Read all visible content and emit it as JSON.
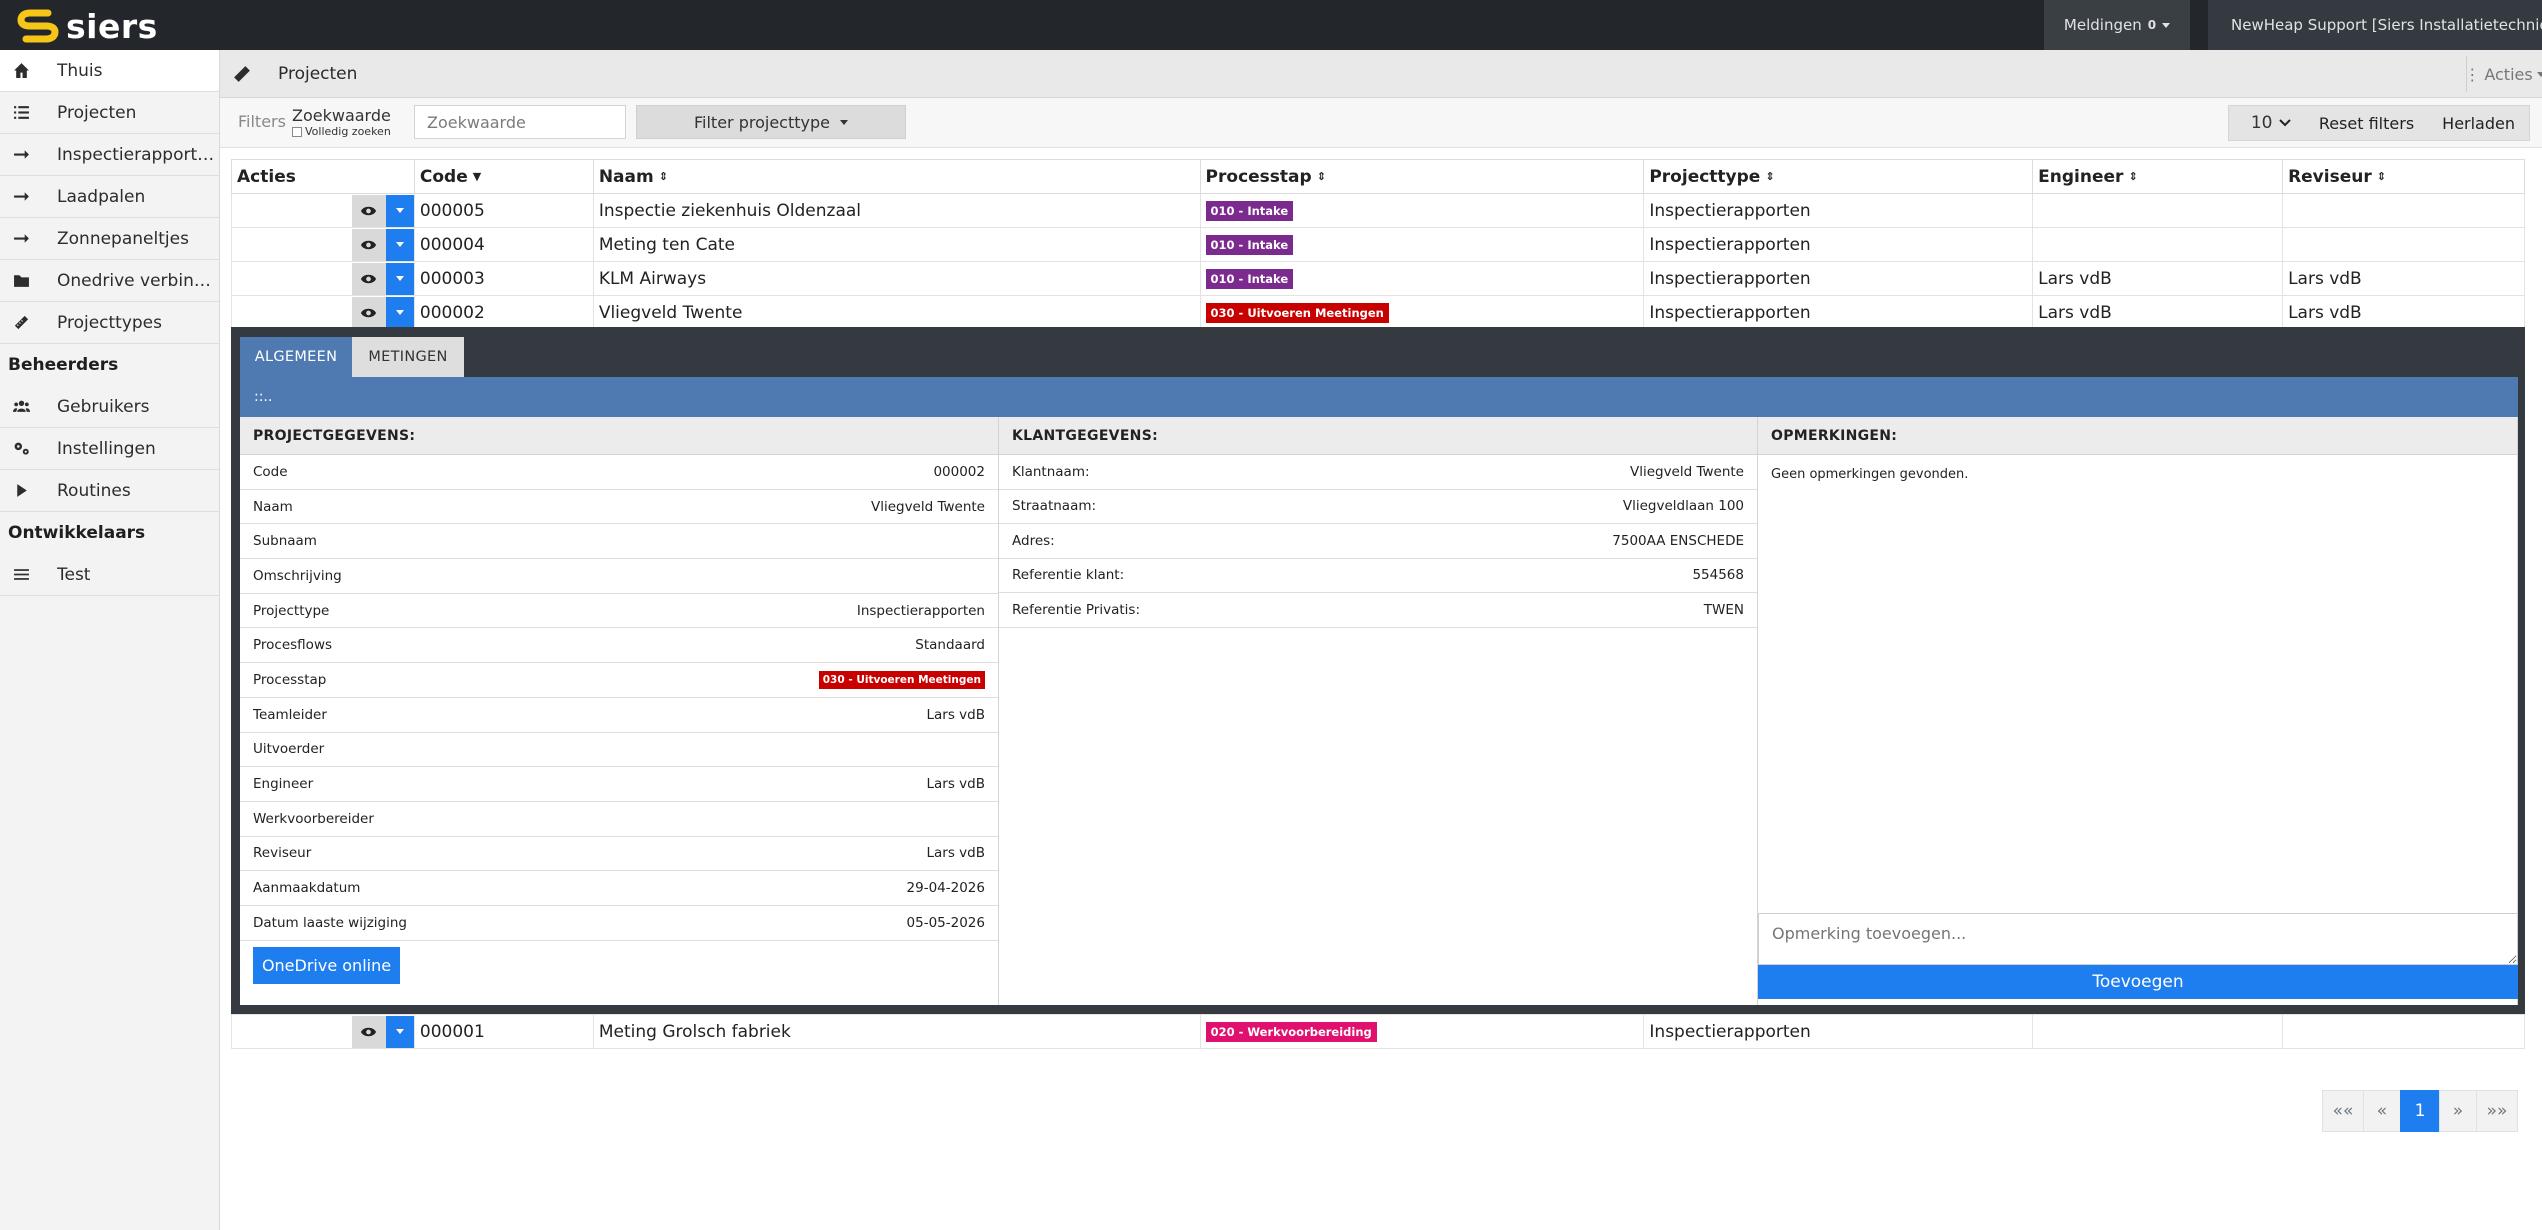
{
  "brand": {
    "name": "siers",
    "logo_color": "#f5c518"
  },
  "topbar": {
    "notifications_label": "Meldingen",
    "notifications_count": "0",
    "user_label": "NewHeap Support [Siers Installatietechniek]"
  },
  "sidebar": {
    "items": [
      {
        "label": "Thuis",
        "icon": "home-icon"
      },
      {
        "label": "Projecten",
        "icon": "list-icon"
      },
      {
        "label": "Inspectierapporten",
        "icon": "arrow-right-icon"
      },
      {
        "label": "Laadpalen",
        "icon": "arrow-right-icon"
      },
      {
        "label": "Zonnepaneltjes",
        "icon": "arrow-right-icon"
      },
      {
        "label": "Onedrive verbindingen",
        "icon": "folder-icon"
      },
      {
        "label": "Projecttypes",
        "icon": "ruler-icon"
      }
    ],
    "admin_heading": "Beheerders",
    "admin_items": [
      {
        "label": "Gebruikers",
        "icon": "users-icon"
      },
      {
        "label": "Instellingen",
        "icon": "gears-icon"
      },
      {
        "label": "Routines",
        "icon": "play-icon"
      }
    ],
    "dev_heading": "Ontwikkelaars",
    "dev_items": [
      {
        "label": "Test",
        "icon": "menu-icon"
      }
    ]
  },
  "page": {
    "title": "Projecten",
    "actions_label": "Acties"
  },
  "filters": {
    "label": "Filters",
    "search_label": "Zoekwaarde",
    "full_search_label": "Volledig zoeken",
    "search_placeholder": "Zoekwaarde",
    "project_type_filter": "Filter projecttype",
    "per_page": "10",
    "reset_label": "Reset filters",
    "reload_label": "Herladen"
  },
  "table": {
    "headers": [
      "Acties",
      "Code",
      "Naam",
      "Processtap",
      "Projecttype",
      "Engineer",
      "Reviseur"
    ],
    "rows": [
      {
        "code": "000005",
        "naam": "Inspectie ziekenhuis Oldenzaal",
        "processtap": "010 - Intake",
        "badge_color": "#7b2a8e",
        "projecttype": "Inspectierapporten",
        "engineer": "",
        "reviseur": ""
      },
      {
        "code": "000004",
        "naam": "Meting ten Cate",
        "processtap": "010 - Intake",
        "badge_color": "#7b2a8e",
        "projecttype": "Inspectierapporten",
        "engineer": "",
        "reviseur": ""
      },
      {
        "code": "000003",
        "naam": "KLM Airways",
        "processtap": "010 - Intake",
        "badge_color": "#7b2a8e",
        "projecttype": "Inspectierapporten",
        "engineer": "Lars vdB",
        "reviseur": "Lars vdB"
      },
      {
        "code": "000002",
        "naam": "Vliegveld Twente",
        "processtap": "030 - Uitvoeren Meetingen",
        "badge_color": "#c80000",
        "projecttype": "Inspectierapporten",
        "engineer": "Lars vdB",
        "reviseur": "Lars vdB"
      }
    ],
    "last_row": {
      "code": "000001",
      "naam": "Meting Grolsch fabriek",
      "processtap": "020 - Werkvoorbereiding",
      "badge_color": "#e0106e",
      "projecttype": "Inspectierapporten",
      "engineer": "",
      "reviseur": ""
    }
  },
  "detail": {
    "tabs": [
      "ALGEMEEN",
      "METINGEN"
    ],
    "bar_text": "::..",
    "project_heading": "PROJECTGEGEVENS:",
    "project_fields": [
      {
        "label": "Code",
        "value": "000002"
      },
      {
        "label": "Naam",
        "value": "Vliegveld Twente"
      },
      {
        "label": "Subnaam",
        "value": ""
      },
      {
        "label": "Omschrijving",
        "value": ""
      },
      {
        "label": "Projecttype",
        "value": "Inspectierapporten"
      },
      {
        "label": "Procesflows",
        "value": "Standaard"
      },
      {
        "label": "Processtap",
        "value": "030 - Uitvoeren Meetingen",
        "badge": true
      },
      {
        "label": "Teamleider",
        "value": "Lars vdB"
      },
      {
        "label": "Uitvoerder",
        "value": ""
      },
      {
        "label": "Engineer",
        "value": "Lars vdB"
      },
      {
        "label": "Werkvoorbereider",
        "value": ""
      },
      {
        "label": "Reviseur",
        "value": "Lars vdB"
      },
      {
        "label": "Aanmaakdatum",
        "value": "29-04-2026"
      },
      {
        "label": "Datum laaste wijziging",
        "value": "05-05-2026"
      }
    ],
    "onedrive_label": "OneDrive online",
    "client_heading": "KLANTGEGEVENS:",
    "client_fields": [
      {
        "label": "Klantnaam:",
        "value": "Vliegveld Twente"
      },
      {
        "label": "Straatnaam:",
        "value": "Vliegveldlaan 100"
      },
      {
        "label": "Adres:",
        "value": "7500AA ENSCHEDE"
      },
      {
        "label": "Referentie klant:",
        "value": "554568"
      },
      {
        "label": "Referentie Privatis:",
        "value": "TWEN"
      }
    ],
    "remarks_heading": "OPMERKINGEN:",
    "remarks_empty": "Geen opmerkingen gevonden.",
    "remark_placeholder": "Opmerking toevoegen...",
    "add_label": "Toevoegen"
  },
  "pagination": {
    "first": "««",
    "prev": "«",
    "current": "1",
    "next": "»",
    "last": "»»"
  }
}
